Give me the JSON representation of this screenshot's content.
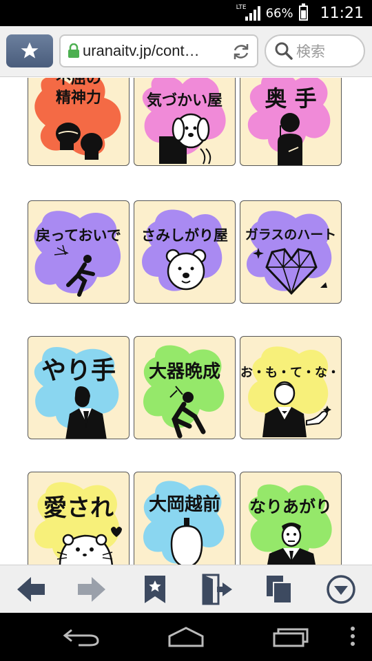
{
  "status_bar": {
    "network": "LTE",
    "battery_percent": "66%",
    "time": "11:21"
  },
  "toolbar": {
    "url": "uranaitv.jp/cont…",
    "search_placeholder": "検索"
  },
  "tiles": [
    {
      "label": "不屈の\n精神力",
      "color": "#f46a45",
      "icon": "boxing-gloves-icon"
    },
    {
      "label": "気づかい屋",
      "color": "#f08ad8",
      "icon": "dog-icon"
    },
    {
      "label": "奥 手",
      "color": "#f08ad8",
      "icon": "shy-person-icon"
    },
    {
      "label": "戻っておいで",
      "color": "#a98af2",
      "icon": "running-person-icon"
    },
    {
      "label": "さみしがり屋",
      "color": "#a98af2",
      "icon": "bear-face-icon"
    },
    {
      "label": "ガラスのハート",
      "color": "#a98af2",
      "icon": "crystal-heart-icon"
    },
    {
      "label": "やり手",
      "color": "#8ad6f0",
      "icon": "businessman-icon"
    },
    {
      "label": "大器晩成",
      "color": "#95e86a",
      "icon": "climber-icon"
    },
    {
      "label": "お・も・て・な・し",
      "color": "#f7f07a",
      "icon": "host-icon"
    },
    {
      "label": "愛され",
      "color": "#f7f07a",
      "icon": "hamster-icon"
    },
    {
      "label": "大岡越前",
      "color": "#8ad6f0",
      "icon": "samurai-icon"
    },
    {
      "label": "なりあがり",
      "color": "#95e86a",
      "icon": "suit-man-icon"
    }
  ],
  "bottom_nav": {
    "back_icon": "back-arrow-icon",
    "forward_icon": "forward-arrow-icon",
    "bookmark_icon": "bookmark-star-icon",
    "exit_icon": "exit-door-icon",
    "tabs_icon": "tabs-icon",
    "menu_icon": "menu-down-icon"
  },
  "colors": {
    "tile_bg": "#fcefcc",
    "toolbar_accent": "#5a6d8c",
    "nav_icon": "#3d4a60"
  }
}
